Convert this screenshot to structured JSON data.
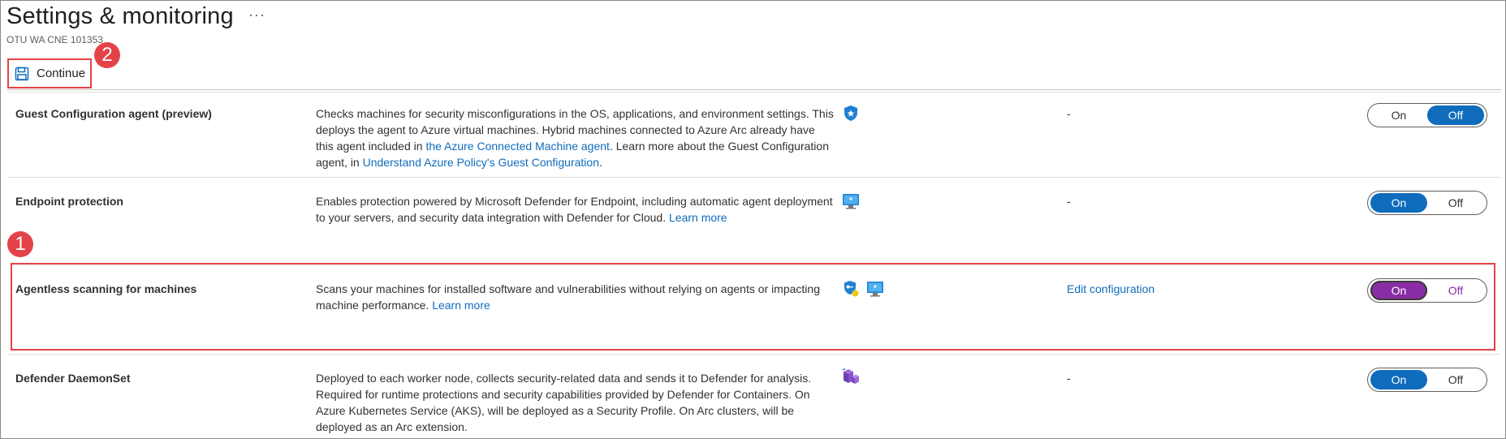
{
  "header": {
    "title": "Settings & monitoring",
    "more_label": "···",
    "subtitle": "OTU WA CNE 101353"
  },
  "toolbar": {
    "continue_label": "Continue"
  },
  "callouts": {
    "one": "1",
    "two": "2"
  },
  "rows": [
    {
      "name": "Guest Configuration agent (preview)",
      "desc_parts": [
        "Checks machines for security misconfigurations in the OS, applications, and environment settings. This deploys the agent to Azure virtual machines. Hybrid machines connected to Azure Arc already have this agent included in ",
        "the Azure Connected Machine agent",
        ". Learn more about the Guest Configuration agent, in ",
        "Understand Azure Policy's Guest Configuration",
        "."
      ],
      "icons": [
        "shield-star-icon"
      ],
      "config": "-",
      "toggle": {
        "on": "On",
        "off": "Off",
        "selected": "Off"
      }
    },
    {
      "name": "Endpoint protection",
      "desc_parts": [
        "Enables protection powered by Microsoft Defender for Endpoint, including automatic agent deployment to your servers, and security data integration with Defender for Cloud. ",
        "Learn more"
      ],
      "icons": [
        "monitor-icon"
      ],
      "config": "-",
      "toggle": {
        "on": "On",
        "off": "Off",
        "selected": "On"
      }
    },
    {
      "name": "Agentless scanning for machines",
      "desc_parts": [
        "Scans your machines for installed software and vulnerabilities without relying on agents or impacting machine performance. ",
        "Learn more"
      ],
      "icons": [
        "shield-key-icon",
        "monitor-icon"
      ],
      "config": "Edit configuration",
      "toggle": {
        "on": "On",
        "off": "Off",
        "selected": "On"
      }
    },
    {
      "name": "Defender DaemonSet",
      "desc_parts": [
        "Deployed to each worker node, collects security-related data and sends it to Defender for analysis. Required for runtime protections and security capabilities provided by Defender for Containers. On Azure Kubernetes Service (AKS), will be deployed as a Security Profile. On Arc clusters, will be deployed as an Arc extension."
      ],
      "icons": [
        "container-cubes-icon"
      ],
      "config": "-",
      "toggle": {
        "on": "On",
        "off": "Off",
        "selected": "On"
      }
    }
  ],
  "colors": {
    "accent": "#0f6cbd",
    "highlight": "#e34348",
    "toggle_purple": "#8a2da5"
  }
}
